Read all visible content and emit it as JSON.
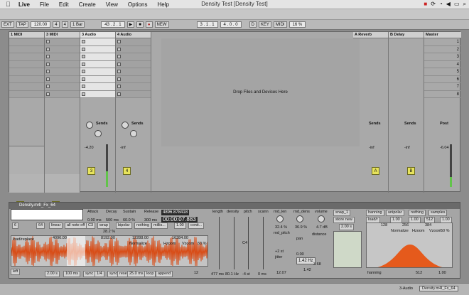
{
  "menubar": {
    "app": "Live",
    "items": [
      "File",
      "Edit",
      "Create",
      "View",
      "Options",
      "Help"
    ],
    "title": "Density Test  [Density Test]"
  },
  "control": {
    "ext": "EXT",
    "tap": "TAP",
    "tempo": "120.00",
    "sig_num": "4",
    "sig_den": "4",
    "bar": "1 Bar",
    "pos": "43 .   2 .   1",
    "loop_start": "3 .   1 .   1",
    "loop_len": "4 .   0 .   0",
    "key": "KEY",
    "midi": "MIDI",
    "cpu": "16 %",
    "new": "NEW",
    "d": "D"
  },
  "tracks": [
    {
      "name": "1 MIDI",
      "num": "1",
      "solo": "S"
    },
    {
      "name": "3 MIDI",
      "num": "2",
      "solo": "S"
    },
    {
      "name": "3 Audio",
      "num": "3",
      "solo": "S",
      "vol": "-4.20"
    },
    {
      "name": "4 Audio",
      "num": "4",
      "solo": "S",
      "vol": "-inf"
    }
  ],
  "returns": [
    {
      "name": "A Reverb",
      "num": "A",
      "vol": "-inf"
    },
    {
      "name": "B Delay",
      "num": "B",
      "vol": "-inf"
    }
  ],
  "master": {
    "name": "Master",
    "scenes": [
      "1",
      "2",
      "3",
      "4",
      "5",
      "6",
      "7",
      "8"
    ],
    "vol": "-6.04",
    "post": "Post"
  },
  "session": {
    "drop": "Drop Files and Devices Here",
    "sends": "Sends",
    "scale": [
      "6",
      "0",
      "6",
      "12",
      "24",
      "36",
      "60"
    ]
  },
  "device": {
    "title": "Density.m4l_Fx_64",
    "env": {
      "attack": "Attack",
      "decay": "Decay",
      "sustain": "Sustain",
      "release": "Release",
      "attack_v": "0.00 ms",
      "decay_v": "500 ms",
      "sustain_v": "60.0 %",
      "release_v": "300 ms"
    },
    "sr": "4896.878418",
    "time": "00:00:07.883",
    "midi_in": "6",
    "c3": "C3",
    "v64": "64",
    "note": "linear",
    "all_note": "all note off",
    "wrap": "wrap",
    "bipolar": "bipolar",
    "nothing": "nothing",
    "millis": "millis...",
    "one": "1.00",
    "conti": "conti...",
    "pct": "28.2 %",
    "wave_ticks": [
      "4096.00",
      "8192.00",
      "12288.00",
      "16384.00"
    ],
    "load": "load/replace",
    "normalize": "Normalize",
    "hzoom": "Hzoom",
    "vzoom": "Vzoom",
    "zoompct": "50 %",
    "foot": {
      "left": "left",
      "a": "2.00 s",
      "b": "100 ms",
      "sync": "sync",
      "quarter": "1/4",
      "sync2": "sync",
      "reset": "reset",
      "bpm": "25.0 ms",
      "loop": "loop",
      "append": "append",
      "c": "12"
    },
    "cols": [
      {
        "label": "length",
        "v": "477 ms"
      },
      {
        "label": "density",
        "v": "80.1 Hz"
      },
      {
        "label": "pitch",
        "v": "-4 st"
      },
      {
        "label": "scann",
        "v": "0 ms"
      }
    ],
    "pitch_label": "C4",
    "rnd_len": "rnd_len",
    "rnd_len_v": "32.4 %",
    "rnd_dens": "rnd_dens",
    "rnd_dens_v": "36.9 %",
    "volume": "volume",
    "volume_v": "4.7 dB",
    "rnd_pitch": "rnd_pitch",
    "rnd_pitch_v": "+2 st",
    "pan": "pan",
    "pan_v": "0.00",
    "distance": "distance",
    "jitter": "jitter",
    "jitter_v": "12.07",
    "freq": "1.42 Hz",
    "ms_v": "3.68",
    "wc": "1.42",
    "snap": "snap_1",
    "store": "store new",
    "two": "2.00 s",
    "win": {
      "hanning": "hanning",
      "unipolar": "unipolar",
      "nothing": "nothing",
      "samples": "samples",
      "load": "load/r",
      "one": "1.00",
      "v1": "1.00",
      "v512": "512",
      "v100": "1.00",
      "ticks": [
        "128",
        "256",
        "384"
      ],
      "normalize": "Normalize",
      "hzoom": "Hzoom",
      "vzoom": "Vzoom",
      "pct": "50 %",
      "hanning2": "hanning",
      "b512": "512",
      "b100": "1.00"
    }
  },
  "status": {
    "track": "3-Audio",
    "device": "Density.m4l_Fx_64"
  }
}
